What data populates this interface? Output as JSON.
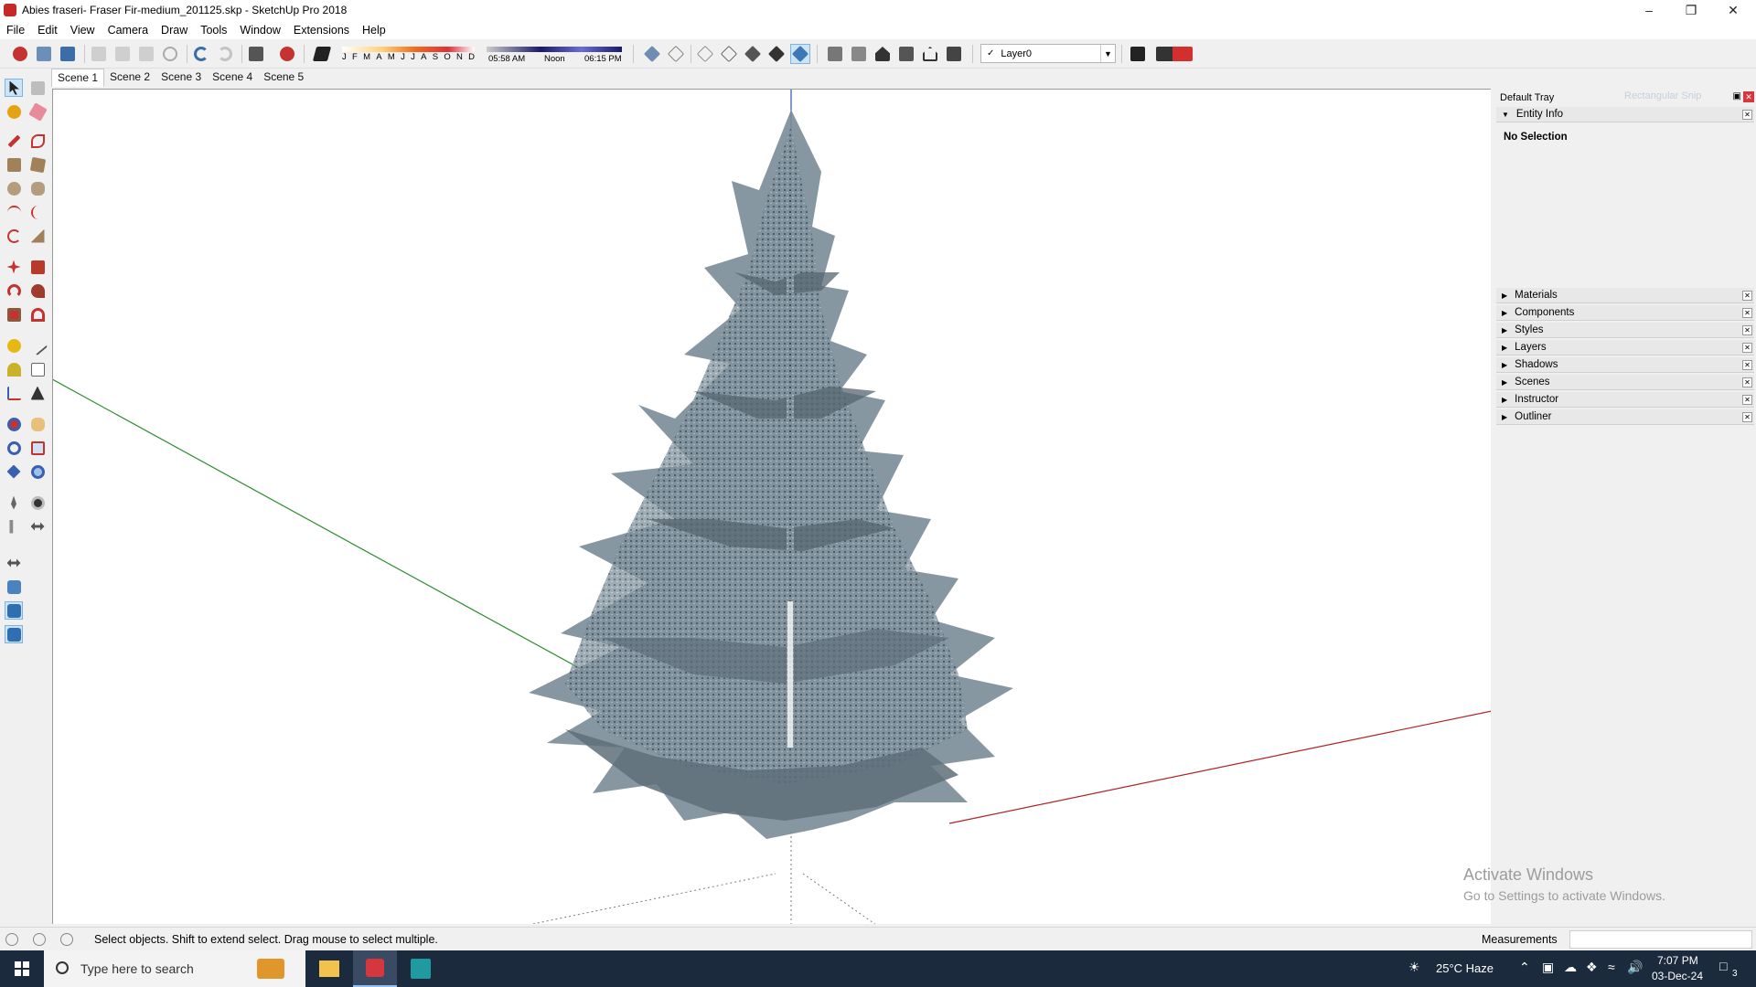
{
  "window": {
    "title": "Abies fraseri- Fraser Fir-medium_201125.skp - SketchUp Pro 2018",
    "controls": [
      "minimize-icon",
      "restore-icon",
      "close-icon"
    ]
  },
  "menu": [
    "File",
    "Edit",
    "View",
    "Camera",
    "Draw",
    "Tools",
    "Window",
    "Extensions",
    "Help"
  ],
  "shadow_settings": {
    "months": [
      "J",
      "F",
      "M",
      "A",
      "M",
      "J",
      "J",
      "A",
      "S",
      "O",
      "N",
      "D"
    ],
    "sunrise": "05:58 AM",
    "noon": "Noon",
    "sunset": "06:15 PM"
  },
  "layer": {
    "checkmark": "✓",
    "current": "Layer0"
  },
  "scenes": [
    "Scene 1",
    "Scene 2",
    "Scene 3",
    "Scene 4",
    "Scene 5"
  ],
  "active_scene": "Scene 1",
  "tray": {
    "title": "Default Tray",
    "ghost_text": "Rectangular Snip",
    "entity_info": {
      "header": "Entity Info",
      "status": "No Selection"
    },
    "panels": [
      "Materials",
      "Components",
      "Styles",
      "Layers",
      "Shadows",
      "Scenes",
      "Instructor",
      "Outliner"
    ]
  },
  "watermark": {
    "line1": "Activate Windows",
    "line2": "Go to Settings to activate Windows."
  },
  "statusbar": {
    "hint": "Select objects. Shift to extend select. Drag mouse to select multiple.",
    "measurements_label": "Measurements",
    "measurements_value": ""
  },
  "taskbar": {
    "search_placeholder": "Type here to search",
    "weather": "25°C  Haze",
    "time": "7:07 PM",
    "date": "03-Dec-24",
    "notification_count": "3"
  },
  "colors": {
    "axis_green": "#2e8b2e",
    "axis_red": "#b22222",
    "axis_blue": "#2f4fb0",
    "foliage": "#6f8390",
    "taskbar": "#1c2a3e"
  }
}
